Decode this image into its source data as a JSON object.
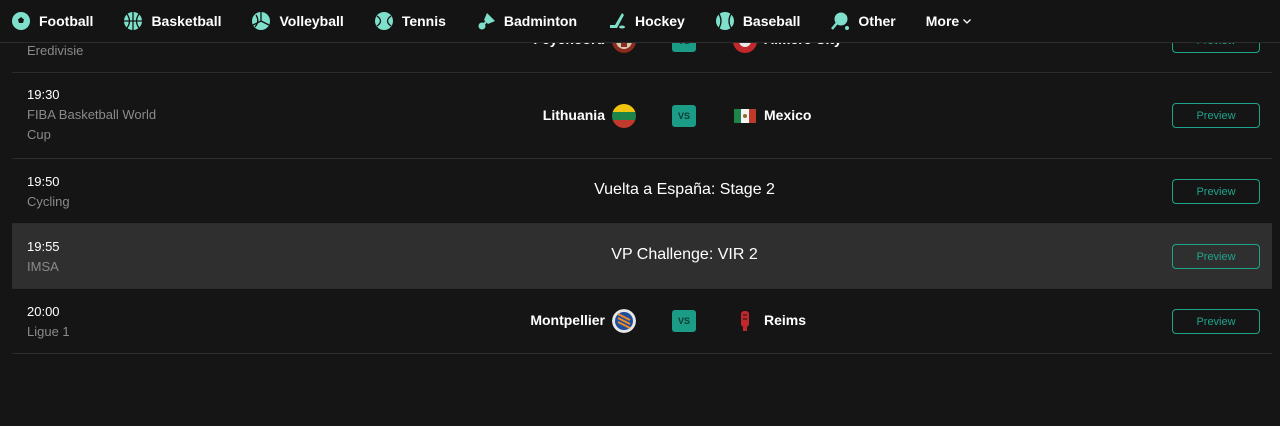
{
  "nav": {
    "items": [
      {
        "label": "Football",
        "icon": "football-icon"
      },
      {
        "label": "Basketball",
        "icon": "basketball-icon"
      },
      {
        "label": "Volleyball",
        "icon": "volleyball-icon"
      },
      {
        "label": "Tennis",
        "icon": "tennis-icon"
      },
      {
        "label": "Badminton",
        "icon": "badminton-icon"
      },
      {
        "label": "Hockey",
        "icon": "hockey-icon"
      },
      {
        "label": "Baseball",
        "icon": "baseball-icon"
      },
      {
        "label": "Other",
        "icon": "other-sports-icon"
      }
    ],
    "more_label": "More"
  },
  "accent_color": "#1fa48c",
  "rows": [
    {
      "time": "",
      "league": "Eredivisie",
      "home": "Feyenoord",
      "away": "Almere City",
      "vs": "VS",
      "preview": "Preview"
    },
    {
      "time": "19:30",
      "league_line1": "FIBA Basketball World",
      "league_line2": "Cup",
      "home": "Lithuania",
      "away": "Mexico",
      "vs": "VS",
      "preview": "Preview"
    },
    {
      "time": "19:50",
      "league": "Cycling",
      "title": "Vuelta a España: Stage 2",
      "preview": "Preview"
    },
    {
      "time": "19:55",
      "league": "IMSA",
      "title": "VP Challenge: VIR 2",
      "preview": "Preview"
    },
    {
      "time": "20:00",
      "league": "Ligue 1",
      "home": "Montpellier",
      "away": "Reims",
      "vs": "VS",
      "preview": "Preview"
    }
  ]
}
